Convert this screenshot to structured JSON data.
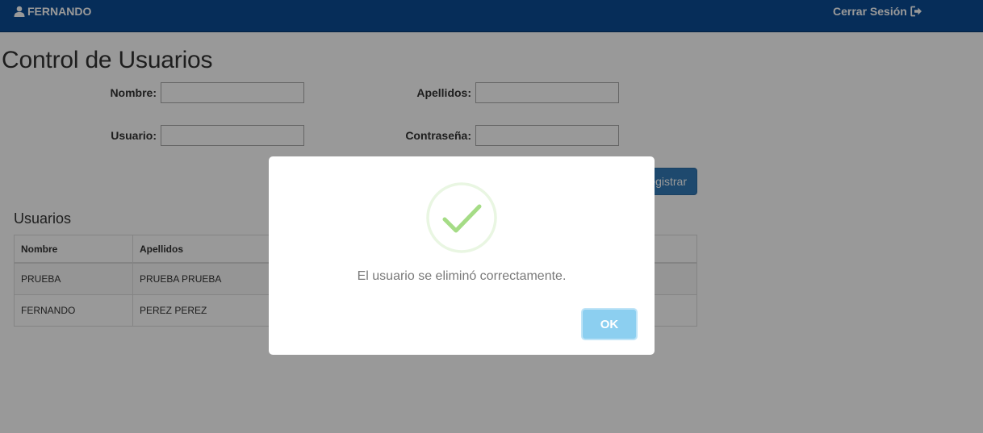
{
  "navbar": {
    "username": "FERNANDO",
    "user_icon": "user-icon",
    "logout_label": "Cerrar Sesión",
    "logout_icon": "logout-icon",
    "background_color": "#0b4b94"
  },
  "page": {
    "title": "Control de Usuarios"
  },
  "form": {
    "nombre_label": "Nombre:",
    "nombre_value": "",
    "apellidos_label": "Apellidos:",
    "apellidos_value": "",
    "usuario_label": "Usuario:",
    "usuario_value": "",
    "contrasena_label": "Contraseña:",
    "contrasena_value": "",
    "register_label": "Registrar"
  },
  "users_section": {
    "title": "Usuarios",
    "columns": [
      "Nombre",
      "Apellidos"
    ],
    "rows": [
      {
        "nombre": "PRUEBA",
        "apellidos": "PRUEBA PRUEBA"
      },
      {
        "nombre": "FERNANDO",
        "apellidos": "PEREZ PEREZ"
      }
    ]
  },
  "modal": {
    "icon": "success-check-icon",
    "message": "El usuario se eliminó correctamente.",
    "ok_label": "OK",
    "ok_color": "#8ccff0",
    "check_color": "#a5dc86"
  }
}
